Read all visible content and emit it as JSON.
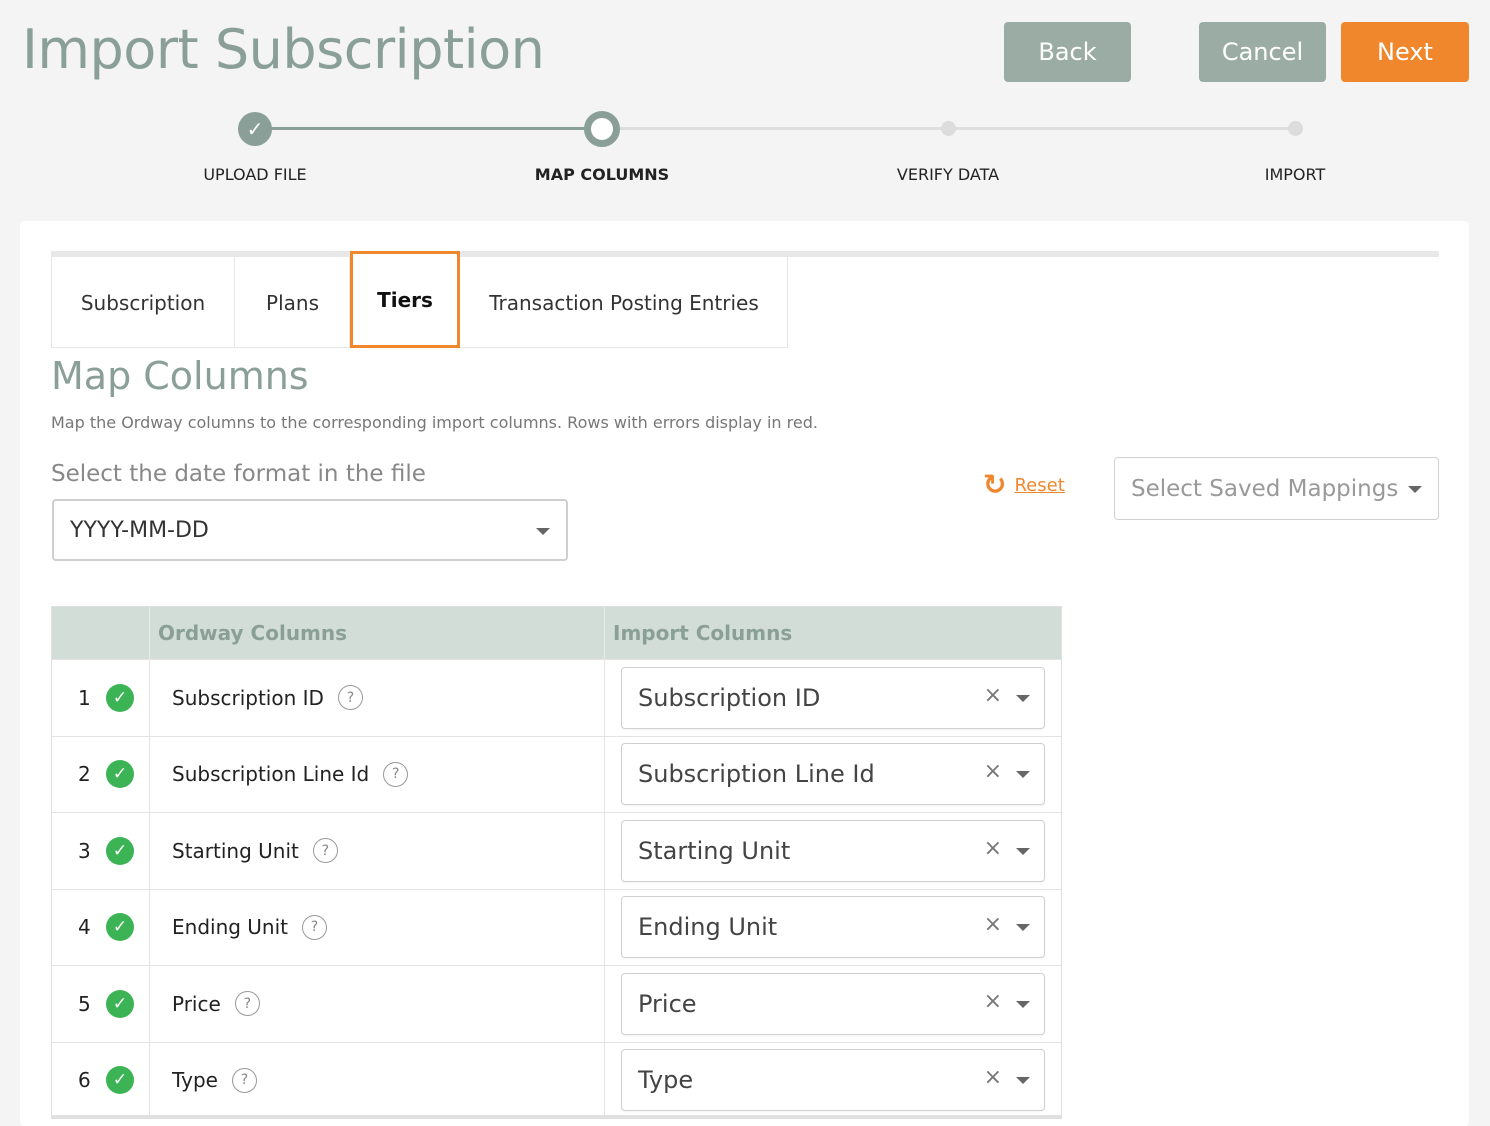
{
  "header": {
    "title": "Import Subscription",
    "back_label": "Back",
    "cancel_label": "Cancel",
    "next_label": "Next"
  },
  "stepper": {
    "steps": [
      {
        "label": "UPLOAD FILE",
        "status": "done"
      },
      {
        "label": "MAP COLUMNS",
        "status": "current"
      },
      {
        "label": "VERIFY DATA",
        "status": "todo"
      },
      {
        "label": "IMPORT",
        "status": "todo"
      }
    ]
  },
  "tabs": [
    {
      "label": "Subscription"
    },
    {
      "label": "Plans"
    },
    {
      "label": "Tiers",
      "active": true
    },
    {
      "label": "Transaction Posting Entries"
    }
  ],
  "section": {
    "title": "Map Columns",
    "description": "Map the Ordway columns to the corresponding import columns. Rows with errors display in red.",
    "date_format_label": "Select the date format in the file",
    "date_format_value": "YYYY-MM-DD",
    "reset_label": "Reset",
    "saved_mappings_placeholder": "Select Saved Mappings"
  },
  "table": {
    "headers": {
      "ordway": "Ordway Columns",
      "import": "Import Columns"
    },
    "rows": [
      {
        "index": "1",
        "ordway": "Subscription ID",
        "import": "Subscription ID"
      },
      {
        "index": "2",
        "ordway": "Subscription Line Id",
        "import": "Subscription Line Id"
      },
      {
        "index": "3",
        "ordway": "Starting Unit",
        "import": "Starting Unit"
      },
      {
        "index": "4",
        "ordway": "Ending Unit",
        "import": "Ending Unit"
      },
      {
        "index": "5",
        "ordway": "Price",
        "import": "Price"
      },
      {
        "index": "6",
        "ordway": "Type",
        "import": "Type"
      }
    ]
  },
  "colors": {
    "accent": "#f0872d",
    "muted_green": "#8a9f97",
    "success": "#3cb455"
  }
}
